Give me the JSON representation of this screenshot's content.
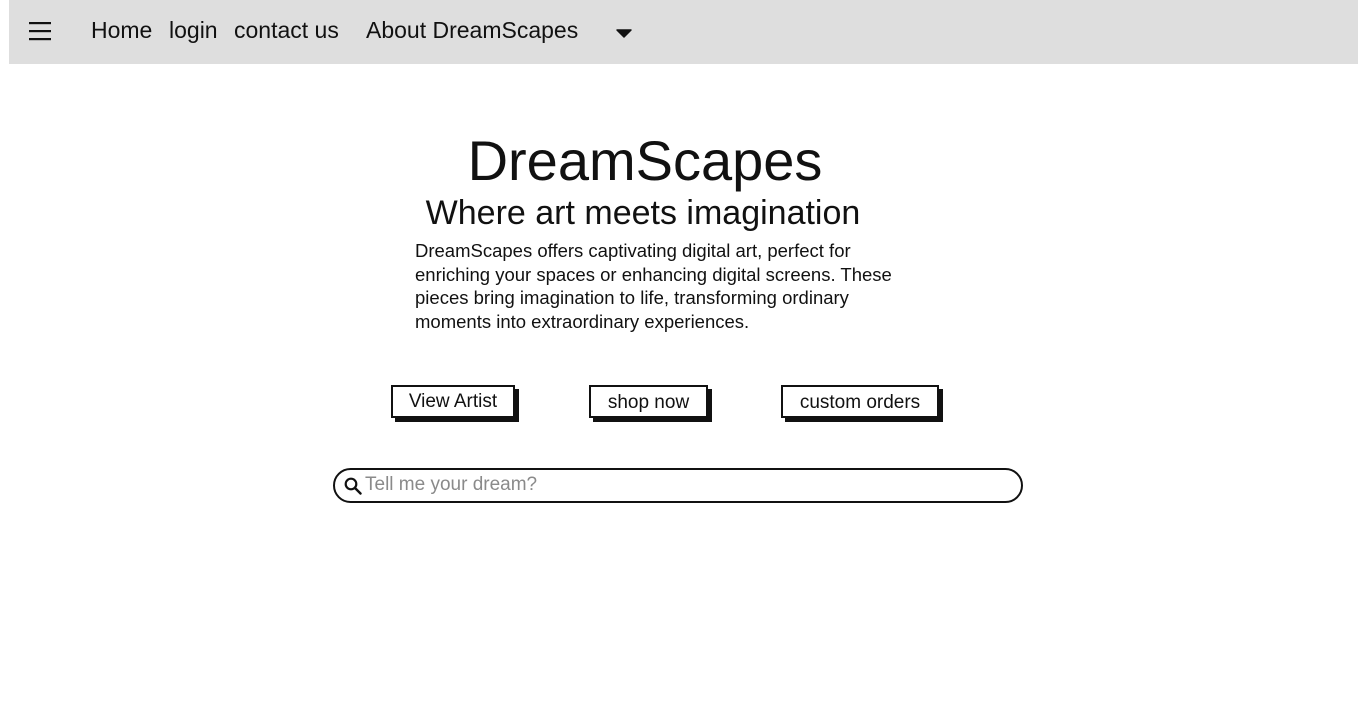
{
  "nav": {
    "menu_icon": "hamburger-menu-icon",
    "links": [
      {
        "label": "Home"
      },
      {
        "label": "login"
      },
      {
        "label": "contact us"
      },
      {
        "label": "About DreamScapes"
      }
    ],
    "dropdown_icon": "caret-down-icon"
  },
  "hero": {
    "title": "DreamScapes",
    "subtitle": "Where art meets imagination",
    "description": "DreamScapes offers captivating digital art, perfect for enriching your spaces or enhancing digital screens. These pieces bring imagination to life, transforming ordinary moments into extraordinary experiences."
  },
  "buttons": {
    "view_artist": "View Artist",
    "shop_now": "shop now",
    "custom_orders": "custom orders"
  },
  "search": {
    "icon": "search-icon",
    "placeholder": "Tell me your dream?",
    "value": ""
  },
  "colors": {
    "navbar_bg": "#dedede",
    "text": "#111111",
    "placeholder": "#8a8a8a"
  }
}
